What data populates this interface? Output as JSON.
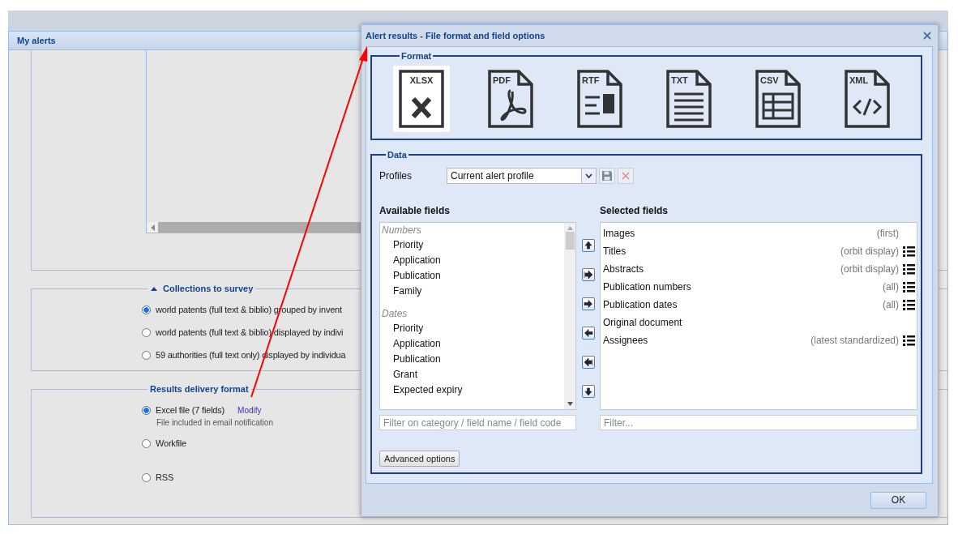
{
  "panel": {
    "title": "My alerts"
  },
  "collections": {
    "title": "Collections to survey",
    "expanded": true,
    "options": [
      {
        "label": "world patents (full text & biblio) grouped by invent",
        "selected": true
      },
      {
        "label": "world patents (full text & biblio) displayed by indivi",
        "selected": false
      },
      {
        "label": "59 authorities (full text only) displayed by individua",
        "selected": false
      }
    ]
  },
  "delivery": {
    "title": "Results delivery format",
    "options": [
      {
        "label": "Excel file (7 fields)",
        "selected": true,
        "link": "Modify",
        "note": "File included in email notification"
      },
      {
        "label": "Workfile",
        "selected": false
      },
      {
        "label": "RSS",
        "selected": false
      }
    ]
  },
  "dialog": {
    "title": "Alert results - File format and field options",
    "format": {
      "legend": "Format",
      "options": [
        {
          "kind": "xlsx",
          "label": "XLSX",
          "selected": true
        },
        {
          "kind": "pdf",
          "label": "PDF",
          "selected": false
        },
        {
          "kind": "rtf",
          "label": "RTF",
          "selected": false
        },
        {
          "kind": "txt",
          "label": "TXT",
          "selected": false
        },
        {
          "kind": "csv",
          "label": "CSV",
          "selected": false
        },
        {
          "kind": "xml",
          "label": "XML",
          "selected": false
        }
      ]
    },
    "data": {
      "legend": "Data",
      "profiles_label": "Profiles",
      "profile_value": "Current alert profile",
      "available": {
        "heading": "Available fields",
        "filter_placeholder": "Filter on category / field name / field code",
        "groups": [
          {
            "label": "Numbers",
            "children": [
              {
                "label": "Priority",
                "selected": false
              },
              {
                "label": "Application",
                "selected": false
              },
              {
                "label": "Publication",
                "selected": false
              },
              {
                "label": "Family",
                "selected": false
              }
            ]
          },
          {
            "label": "Dates",
            "children": [
              {
                "label": "Priority",
                "selected": false
              },
              {
                "label": "Application",
                "selected": false
              },
              {
                "label": "Publication",
                "selected": false
              },
              {
                "label": "Grant",
                "selected": false
              },
              {
                "label": "Expected expiry",
                "selected": false
              }
            ]
          }
        ]
      },
      "selected": {
        "heading": "Selected fields",
        "filter_placeholder": "Filter...",
        "items": [
          {
            "label": "Images",
            "detail": "(first)",
            "options_icon": false,
            "selected": false
          },
          {
            "label": "Titles",
            "detail": "(orbit display)",
            "options_icon": true,
            "selected": false
          },
          {
            "label": "Abstracts",
            "detail": "(orbit display)",
            "options_icon": true,
            "selected": false
          },
          {
            "label": "Publication numbers",
            "detail": "(all)",
            "options_icon": true,
            "selected": false
          },
          {
            "label": "Publication dates",
            "detail": "(all)",
            "options_icon": true,
            "selected": false
          },
          {
            "label": "Original document",
            "options_icon": false,
            "selected": false
          },
          {
            "label": "Assignees",
            "detail": "(latest standardized)",
            "options_icon": true,
            "selected": false
          }
        ]
      },
      "advanced_button": "Advanced options"
    },
    "ok_button": "OK"
  }
}
